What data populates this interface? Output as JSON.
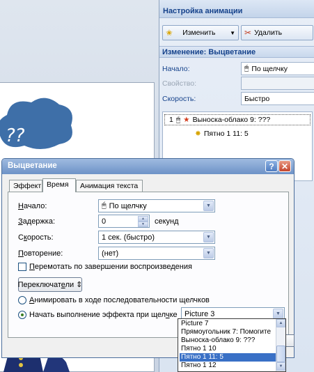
{
  "pane": {
    "title": "Настройка анимации",
    "change_button": "Изменить",
    "delete_button": "Удалить",
    "subtitle": "Изменение: Выцветание",
    "start_label": "Начало:",
    "start_value": "По щелчку",
    "property_label": "Свойство:",
    "speed_label": "Скорость:",
    "speed_value": "Быстро",
    "animation_items": [
      {
        "number": "1",
        "label": "Выноска-облако 9: ???"
      },
      {
        "number": "",
        "label": "Пятно 1 11: 5"
      }
    ]
  },
  "slide": {
    "cloud_text": "??"
  },
  "dialog": {
    "title": "Выцветание",
    "help_button": "?",
    "close_button": "✕",
    "tabs": [
      "Эффект",
      "Время",
      "Анимация текста"
    ],
    "active_tab_index": 1,
    "start_label_pre": "",
    "start_label_u": "Н",
    "start_label_post": "ачало:",
    "start_value": "По щелчку",
    "delay_label_u": "З",
    "delay_label_post": "адержка:",
    "delay_value": "0",
    "delay_unit": "секунд",
    "speed_label_pre": "С",
    "speed_label_u": "к",
    "speed_label_post": "орость:",
    "speed_value": "1 сек. (быстро)",
    "repeat_label_u": "П",
    "repeat_label_post": "овторение:",
    "repeat_value": "(нет)",
    "rewind_pre": "",
    "rewind_u": "П",
    "rewind_post": "еремотать по завершении воспроизведения",
    "rewind_checked": false,
    "triggers_pre": "Переключат",
    "triggers_u": "е",
    "triggers_post": "ли",
    "triggers_arrow": "⇕",
    "animate_sequence_u": "А",
    "animate_sequence_post": "нимировать в ходе последовательности щелчков",
    "start_effect_pre": "Начать выполнение эффекта при щел",
    "start_effect_u": "ч",
    "start_effect_post": "ке",
    "start_effect_selected": true,
    "trigger_object": "Picture 3",
    "trigger_options": [
      "Picture 7",
      "Прямоугольник 7: Помогите",
      "Выноска-облако 9: ???",
      "Пятно 1 10",
      "Пятно 1 11: 5",
      "Пятно 1 12"
    ],
    "trigger_selected_index": 4
  },
  "colors": {
    "accent": "#15428b",
    "title_bar": "#6d92c7",
    "close_red": "#c4452d",
    "selection": "#3970c6",
    "cloud": "#3e6fa8"
  },
  "icons": [
    "add-effect-icon",
    "delete-effect-icon",
    "mouse-click-icon",
    "star-effect-icon",
    "burst-effect-icon",
    "dropdown-arrow-icon",
    "spin-icon",
    "help-icon",
    "close-icon"
  ]
}
